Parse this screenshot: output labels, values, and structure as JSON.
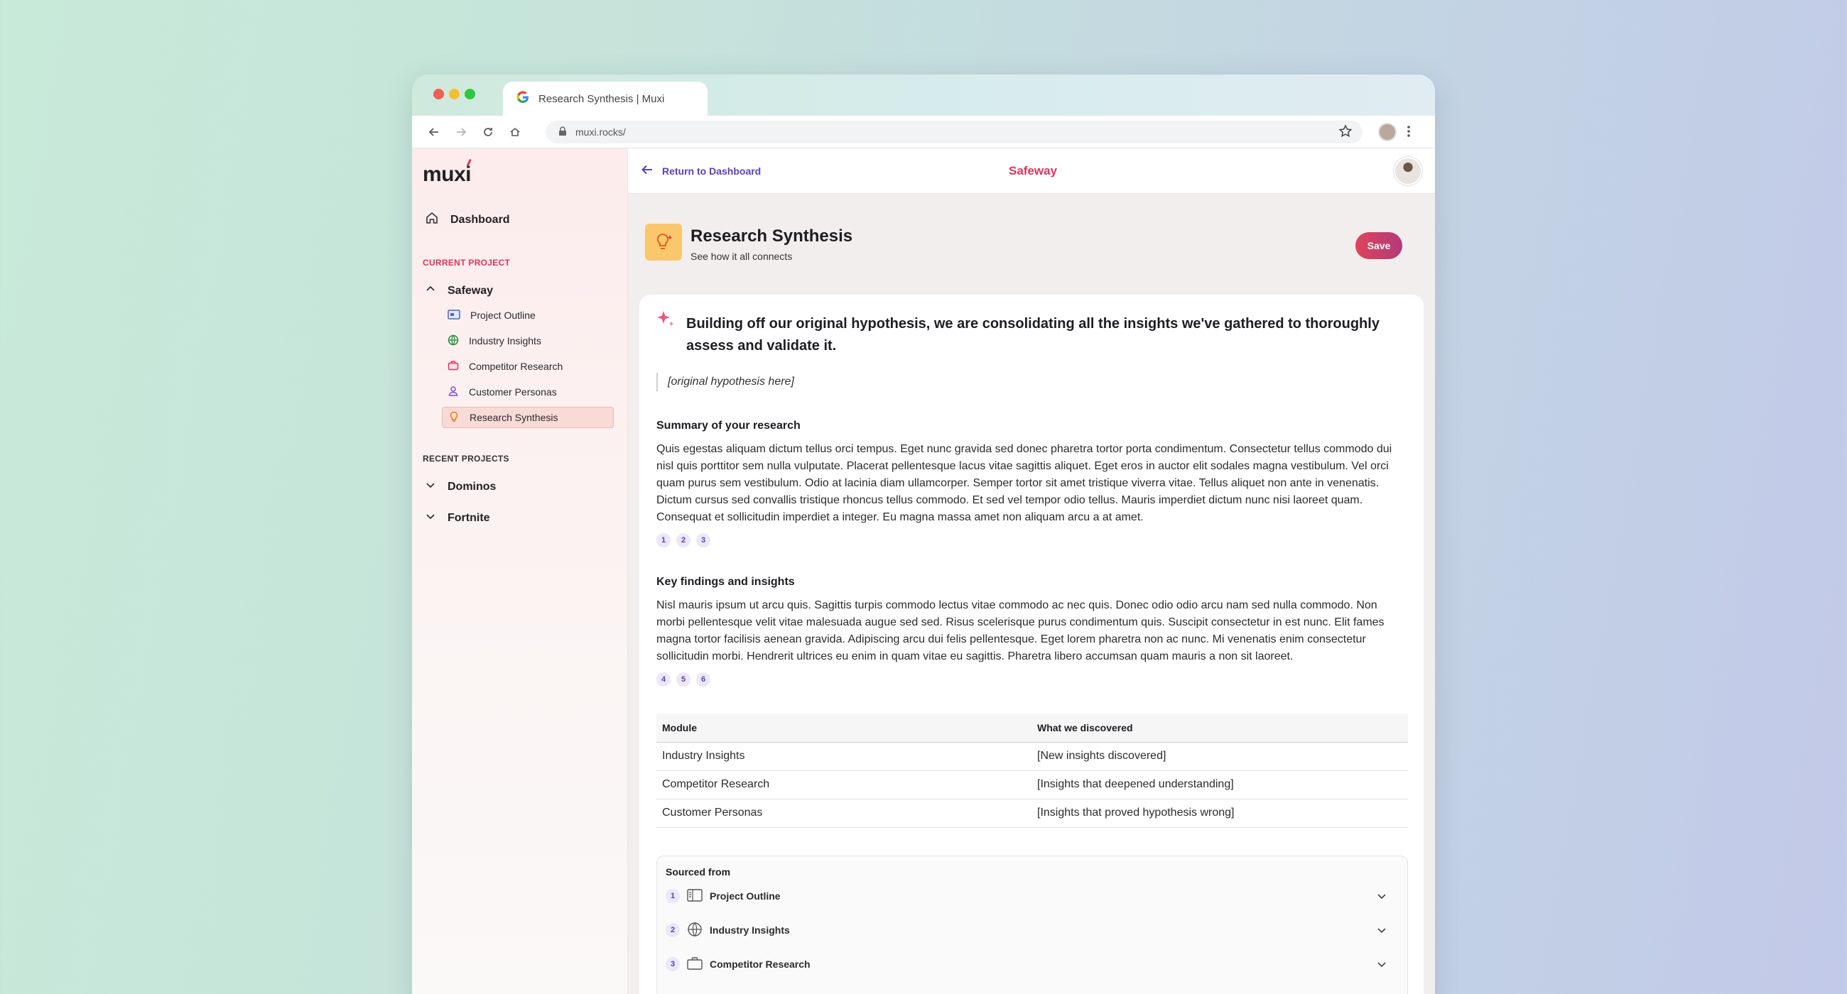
{
  "browser": {
    "tab_title": "Research Synthesis | Muxi",
    "url": "muxi.rocks/"
  },
  "sidebar": {
    "logo": "muxi",
    "dashboard_label": "Dashboard",
    "current_project_label": "CURRENT PROJECT",
    "current_project_name": "Safeway",
    "items": [
      {
        "label": "Project Outline",
        "icon": "outline-icon"
      },
      {
        "label": "Industry Insights",
        "icon": "globe-icon"
      },
      {
        "label": "Competitor Research",
        "icon": "briefcase-icon"
      },
      {
        "label": "Customer Personas",
        "icon": "person-icon"
      },
      {
        "label": "Research Synthesis",
        "icon": "lightbulb-icon"
      }
    ],
    "recent_projects_label": "RECENT PROJECTS",
    "recent_projects": [
      "Dominos",
      "Fortnite"
    ]
  },
  "topbar": {
    "back_label": "Return to Dashboard",
    "project_name": "Safeway"
  },
  "page": {
    "title": "Research Synthesis",
    "subtitle": "See how it all connects",
    "save_label": "Save"
  },
  "content": {
    "hypothesis_intro": "Building off our original hypothesis, we are consolidating all the insights we've gathered to thoroughly assess and validate it.",
    "hypothesis_placeholder": "[original hypothesis here]",
    "summary_heading": "Summary of your research",
    "summary_text": "Quis egestas aliquam dictum tellus orci tempus. Eget nunc gravida sed donec pharetra tortor porta condimentum. Consectetur tellus commodo dui nisl quis porttitor sem nulla vulputate. Placerat pellentesque lacus vitae sagittis aliquet. Eget eros in auctor elit sodales magna vestibulum. Vel orci quam purus sem vestibulum. Odio at lacinia diam ullamcorper. Semper tortor sit amet tristique viverra vitae. Tellus aliquet non ante in venenatis. Dictum cursus sed convallis tristique rhoncus tellus commodo. Et sed vel tempor odio tellus. Mauris imperdiet dictum nunc nisi laoreet quam. Consequat et sollicitudin imperdiet a integer. Eu magna massa amet non aliquam arcu a at amet.",
    "summary_citations": [
      "1",
      "2",
      "3"
    ],
    "findings_heading": "Key findings and insights",
    "findings_text": "Nisl mauris ipsum ut arcu quis. Sagittis turpis commodo lectus vitae commodo ac nec quis. Donec odio odio arcu nam sed nulla commodo. Non morbi pellentesque velit vitae malesuada augue sed sed. Risus scelerisque purus condimentum quis. Suscipit consectetur in est nunc. Elit fames magna tortor facilisis aenean gravida. Adipiscing arcu dui felis pellentesque. Eget lorem pharetra non ac nunc. Mi venenatis enim consectetur sollicitudin morbi. Hendrerit ultrices eu enim in quam vitae eu sagittis. Pharetra libero accumsan quam mauris a non sit laoreet.",
    "findings_citations": [
      "4",
      "5",
      "6"
    ]
  },
  "table": {
    "headers": [
      "Module",
      "What we discovered"
    ],
    "rows": [
      [
        "Industry Insights",
        "[New insights discovered]"
      ],
      [
        "Competitor Research",
        "[Insights that deepened understanding]"
      ],
      [
        "Customer Personas",
        "[Insights that proved hypothesis wrong]"
      ]
    ]
  },
  "sources": {
    "title": "Sourced from",
    "items": [
      {
        "num": "1",
        "label": "Project Outline",
        "icon": "outline-icon"
      },
      {
        "num": "2",
        "label": "Industry Insights",
        "icon": "globe-icon"
      },
      {
        "num": "3",
        "label": "Competitor Research",
        "icon": "briefcase-icon"
      }
    ]
  },
  "colors": {
    "accent": "#e0335b",
    "link": "#5a3fc0",
    "active_bg": "#f8dad6"
  }
}
